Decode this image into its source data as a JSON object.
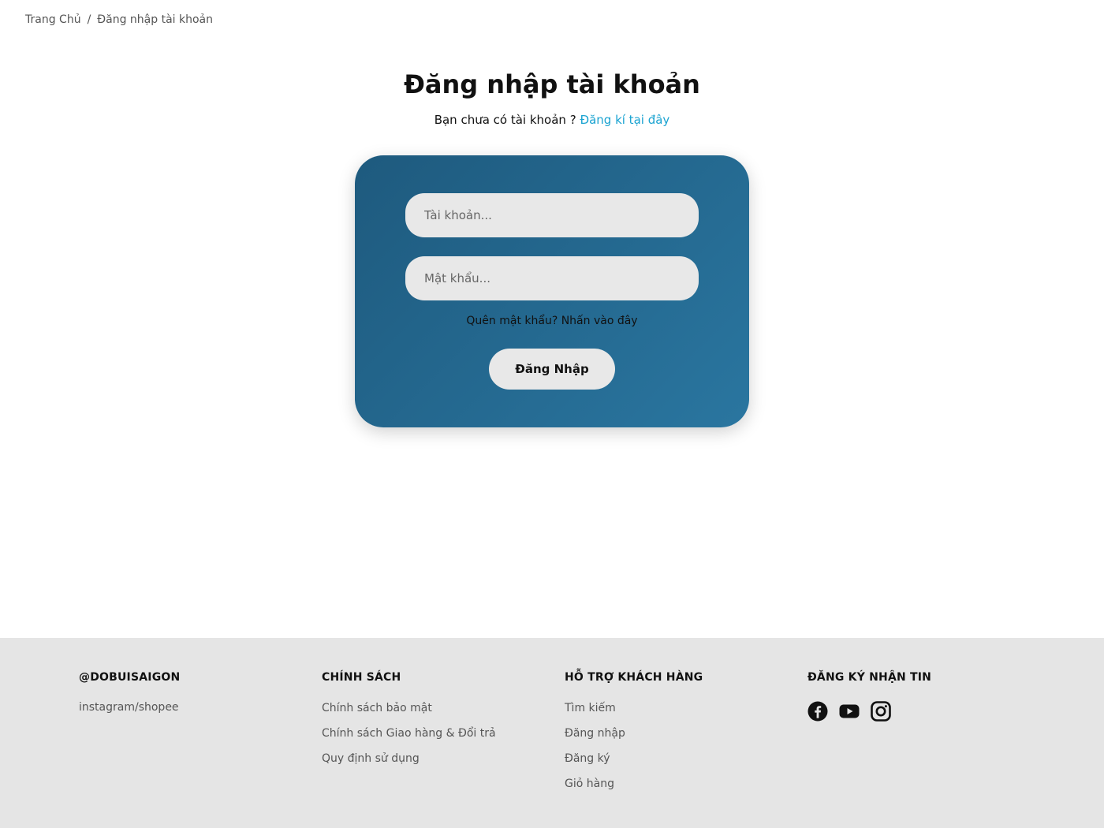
{
  "breadcrumb": {
    "home": "Trang Chủ",
    "separator": "/",
    "current": "Đăng nhập tài khoản"
  },
  "heading": {
    "title": "Đăng nhập tài khoản",
    "subtitle_text": "Bạn chưa có tài khoản ?",
    "register_link": "Đăng kí tại đây"
  },
  "login_form": {
    "username_placeholder": "Tài khoản...",
    "password_placeholder": "Mật khẩu...",
    "forgot_text": "Quên mật khẩu? Nhấn vào đây",
    "submit_label": "Đăng Nhập"
  },
  "footer": {
    "brand": {
      "heading": "@DOBUISAIGON",
      "text": "instagram/shopee"
    },
    "policy": {
      "heading": "CHÍNH SÁCH",
      "items": [
        "Chính sách bảo mật",
        "Chính sách Giao hàng & Đổi trả",
        "Quy định sử dụng"
      ]
    },
    "support": {
      "heading": "HỖ TRỢ KHÁCH HÀNG",
      "items": [
        "Tìm kiếm",
        "Đăng nhập",
        "Đăng ký",
        "Giỏ hàng"
      ]
    },
    "newsletter": {
      "heading": "ĐĂNG KÝ NHẬN TIN",
      "social_icons": [
        "facebook-icon",
        "youtube-icon",
        "instagram-icon"
      ]
    }
  },
  "colors": {
    "accent_link": "#1aa3d1",
    "card_gradient_start": "#1e5a7e",
    "card_gradient_end": "#2a76a0",
    "footer_bg": "#e5e5e5",
    "input_bg": "#e8e8e8"
  }
}
